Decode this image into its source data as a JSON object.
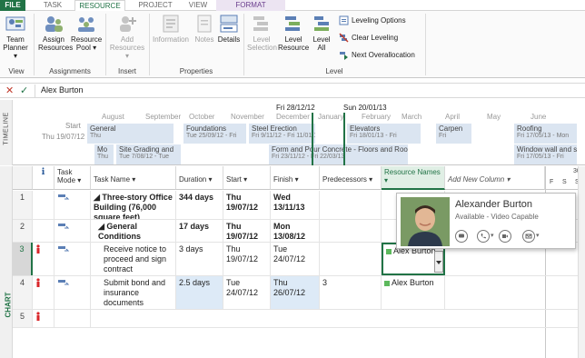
{
  "tabs": [
    "FILE",
    "TASK",
    "RESOURCE",
    "PROJECT",
    "VIEW",
    "FORMAT"
  ],
  "ribbon": {
    "view_group": {
      "label": "View",
      "team_planner": "Team Planner ▾"
    },
    "assignments_group": {
      "label": "Assignments",
      "assign_resources": "Assign Resources",
      "resource_pool": "Resource Pool ▾"
    },
    "insert_group": {
      "label": "Insert",
      "add_resources": "Add Resources ▾"
    },
    "properties_group": {
      "label": "Properties",
      "information": "Information",
      "notes": "Notes",
      "details": "Details"
    },
    "level_group": {
      "label": "Level",
      "level_selection": "Level Selection",
      "level_resource": "Level Resource",
      "level_all": "Level All",
      "leveling_options": "Leveling Options",
      "clear_leveling": "Clear Leveling",
      "next_overallocation": "Next Overallocation"
    }
  },
  "entry_bar": {
    "value": "Alex Burton"
  },
  "timeline": {
    "side_label": "TIMELINE",
    "start_label": "Start",
    "start_date": "Thu 19/07/12",
    "markers": [
      "Fri 28/12/12",
      "Sun 20/01/13"
    ],
    "months": [
      "August",
      "September",
      "October",
      "November",
      "December",
      "January",
      "February",
      "March",
      "April",
      "May",
      "June"
    ],
    "bars": [
      {
        "name": "General",
        "dates": "Thu"
      },
      {
        "name": "Foundations",
        "dates": "Tue 25/09/12 - Fri"
      },
      {
        "name": "Steel Erection",
        "dates": "Fri 9/11/12 - Fri 11/01/13"
      },
      {
        "name": "Elevators",
        "dates": "Fri 18/01/13 - Fri"
      },
      {
        "name": "Carpen",
        "dates": "Fri"
      },
      {
        "name": "Roofing",
        "dates": "Fri 17/05/13 - Mon"
      },
      {
        "name": "Mo",
        "dates": "Thu"
      },
      {
        "name": "Site Grading and",
        "dates": "Tue 7/08/12 - Tue"
      },
      {
        "name": "Form and Pour Concrete - Floors and Roof",
        "dates": "Fri 23/11/12 - Fri 22/03/13"
      },
      {
        "name": "Window wall and sto",
        "dates": "Fri 17/05/13 - Fri"
      }
    ]
  },
  "grid": {
    "side_label": "CHART",
    "headers": {
      "info": "ℹ",
      "task_mode": "Task Mode ▾",
      "task_name": "Task Name ▾",
      "duration": "Duration ▾",
      "start": "Start ▾",
      "finish": "Finish ▾",
      "predecessors": "Predecessors ▾",
      "resource_names": "Resource Names ▾",
      "add_new_column": "Add New Column ▾"
    },
    "gantt_header": {
      "top": "30",
      "days": [
        "F",
        "S",
        "S"
      ]
    },
    "rows": [
      {
        "id": "1",
        "name": "◢ Three-story Office Building (76,000 square feet)",
        "duration": "344 days",
        "start": "Thu 19/07/12",
        "finish": "Wed 13/11/13",
        "pred": "",
        "res": ""
      },
      {
        "id": "2",
        "name": "◢ General Conditions",
        "duration": "17 days",
        "start": "Thu 19/07/12",
        "finish": "Mon 13/08/12",
        "pred": "",
        "res": ""
      },
      {
        "id": "3",
        "name": "Receive notice to proceed and sign contract",
        "duration": "3 days",
        "start": "Thu 19/07/12",
        "finish": "Tue 24/07/12",
        "pred": "",
        "res": "Alex Burton"
      },
      {
        "id": "4",
        "name": "Submit bond and insurance documents",
        "duration": "2.5 days",
        "start": "Tue 24/07/12",
        "finish": "Thu 26/07/12",
        "pred": "3",
        "res": "Alex Burton"
      },
      {
        "id": "5",
        "name": "",
        "duration": "",
        "start": "",
        "finish": "",
        "pred": "",
        "res": ""
      }
    ]
  },
  "contact_card": {
    "name": "Alexander Burton",
    "status": "Available - Video Capable"
  },
  "colors": {
    "accent": "#217346",
    "format_tab": "#6a3d8d",
    "timeline_bar": "#dbe5f1",
    "highlight": "#ddeaf7"
  }
}
